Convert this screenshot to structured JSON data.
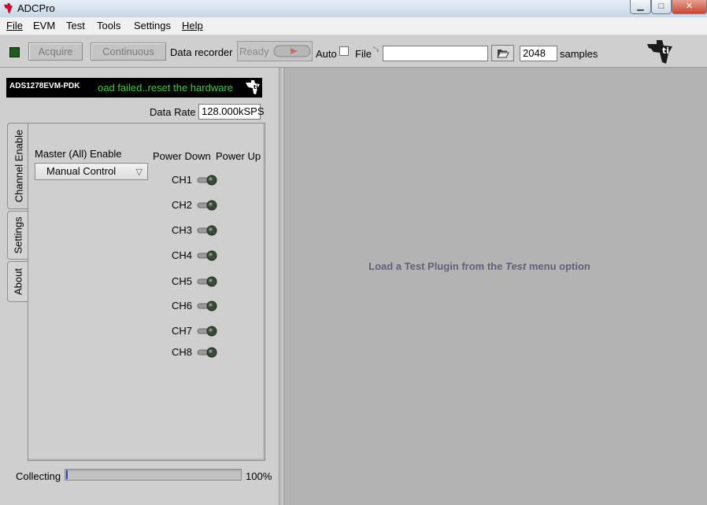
{
  "window": {
    "title": "ADCPro",
    "minimize_glyph": "▁",
    "maximize_glyph": "□",
    "close_glyph": "✕"
  },
  "menu": {
    "items": [
      "File",
      "EVM",
      "Test",
      "Tools",
      "Settings",
      "Help"
    ]
  },
  "toolbar": {
    "acquire_label": "Acquire",
    "continuous_label": "Continuous",
    "data_recorder_label": "Data recorder",
    "status_value": "Ready",
    "auto_label": "Auto",
    "file_label": "File",
    "path_prefix": "␗",
    "path_value": "",
    "samples_value": "2048",
    "samples_label": "samples",
    "folder_icon_glyph": "📂"
  },
  "device": {
    "name": "ADS1278EVM-PDK",
    "status_message": "oad failed..reset the hardware"
  },
  "data_rate": {
    "label": "Data Rate",
    "value": "128.000kSPS"
  },
  "tabs": [
    {
      "label": "Channel Enable",
      "active": true
    },
    {
      "label": "Settings",
      "active": false
    },
    {
      "label": "About",
      "active": false
    }
  ],
  "channel_enable": {
    "master_label": "Master (All) Enable",
    "master_value": "Manual Control",
    "power_down_label": "Power Down",
    "power_up_label": "Power Up",
    "channels": [
      "CH1",
      "CH2",
      "CH3",
      "CH4",
      "CH5",
      "CH6",
      "CH7",
      "CH8"
    ]
  },
  "collecting": {
    "label": "Collecting",
    "percent_text": "100%",
    "fill_fraction": 0.01
  },
  "placeholder": {
    "part1": "Load a Test Plugin from the",
    "part2": "Test",
    "part3": "menu option"
  },
  "colors": {
    "accent_blue": "#1f4fd0",
    "status_green": "#32d232",
    "ti_red": "#c8102e"
  }
}
